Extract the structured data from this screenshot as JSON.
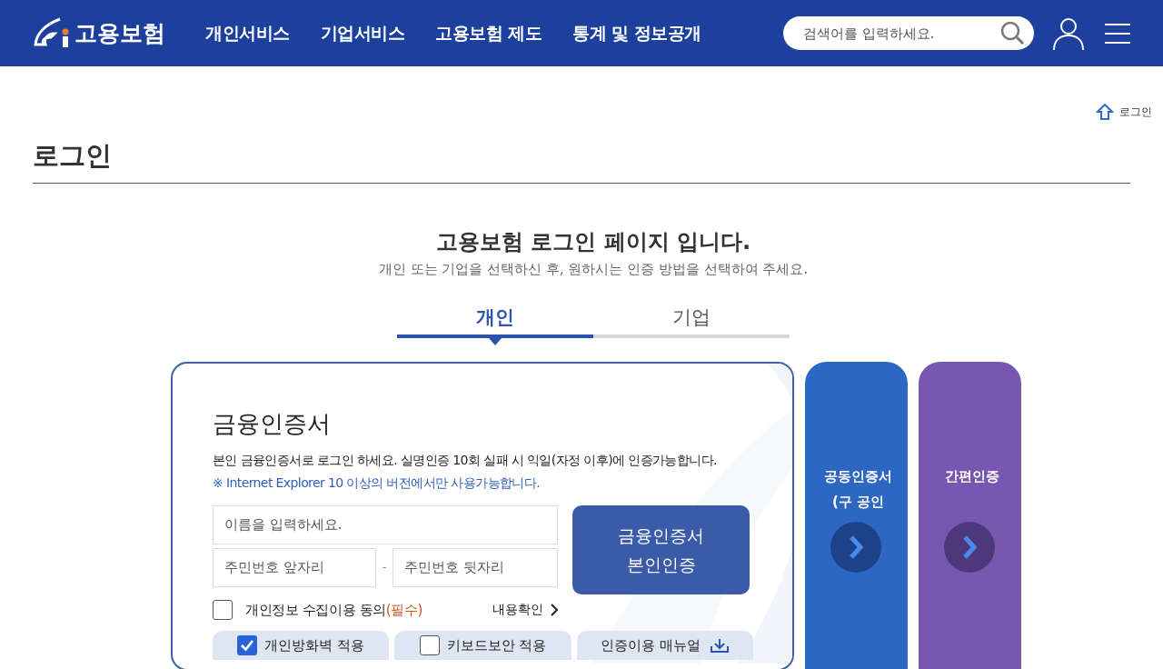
{
  "header": {
    "logo_text": "고용보험",
    "nav": [
      "개인서비스",
      "기업서비스",
      "고용보험 제도",
      "통계 및 정보공개"
    ],
    "search": {
      "placeholder": "검색어를 입력하세요."
    }
  },
  "breadcrumb": "로그인",
  "page_title": "로그인",
  "intro": {
    "heading": "고용보험 로그인 페이지 입니다.",
    "subheading": "개인 또는 기업을 선택하신 후, 원하시는 인증 방법을 선택하여 주세요."
  },
  "tabs": [
    {
      "label": "개인",
      "selected": true
    },
    {
      "label": "기업",
      "selected": false
    }
  ],
  "login_card": {
    "title": "금융인증서",
    "description": "본인 금융인증서로 로그인 하세요. 실명인증 10회 실패 시 익일(자정 이후)에 인증가능합니다.",
    "notice": "※ Internet Explorer 10 이상의 버전에서만 사용가능합니다.",
    "name_field": {
      "placeholder": "이름을 입력하세요."
    },
    "id_front_field": {
      "placeholder": "주민번호 앞자리"
    },
    "id_separator": "-",
    "id_back_field": {
      "placeholder": "주민번호 뒷자리"
    },
    "submit_button": [
      "금융인증서",
      "본인인증"
    ],
    "consent": {
      "label": "개인정보 수집이용 동의",
      "required": "(필수)",
      "checked": false,
      "link": "내용확인"
    },
    "options": [
      {
        "kind": "checkbox",
        "label": "개인방화벽 적용",
        "checked": true
      },
      {
        "kind": "checkbox",
        "label": "키보드보안 적용",
        "checked": false
      },
      {
        "kind": "download",
        "label": "인증이용 매뉴얼"
      }
    ]
  },
  "side_cards": [
    {
      "lines": [
        "공동인증서",
        "(구 공인"
      ],
      "color": "#2e66c4"
    },
    {
      "lines": [
        "간편인증"
      ],
      "color": "#7757b0"
    }
  ]
}
